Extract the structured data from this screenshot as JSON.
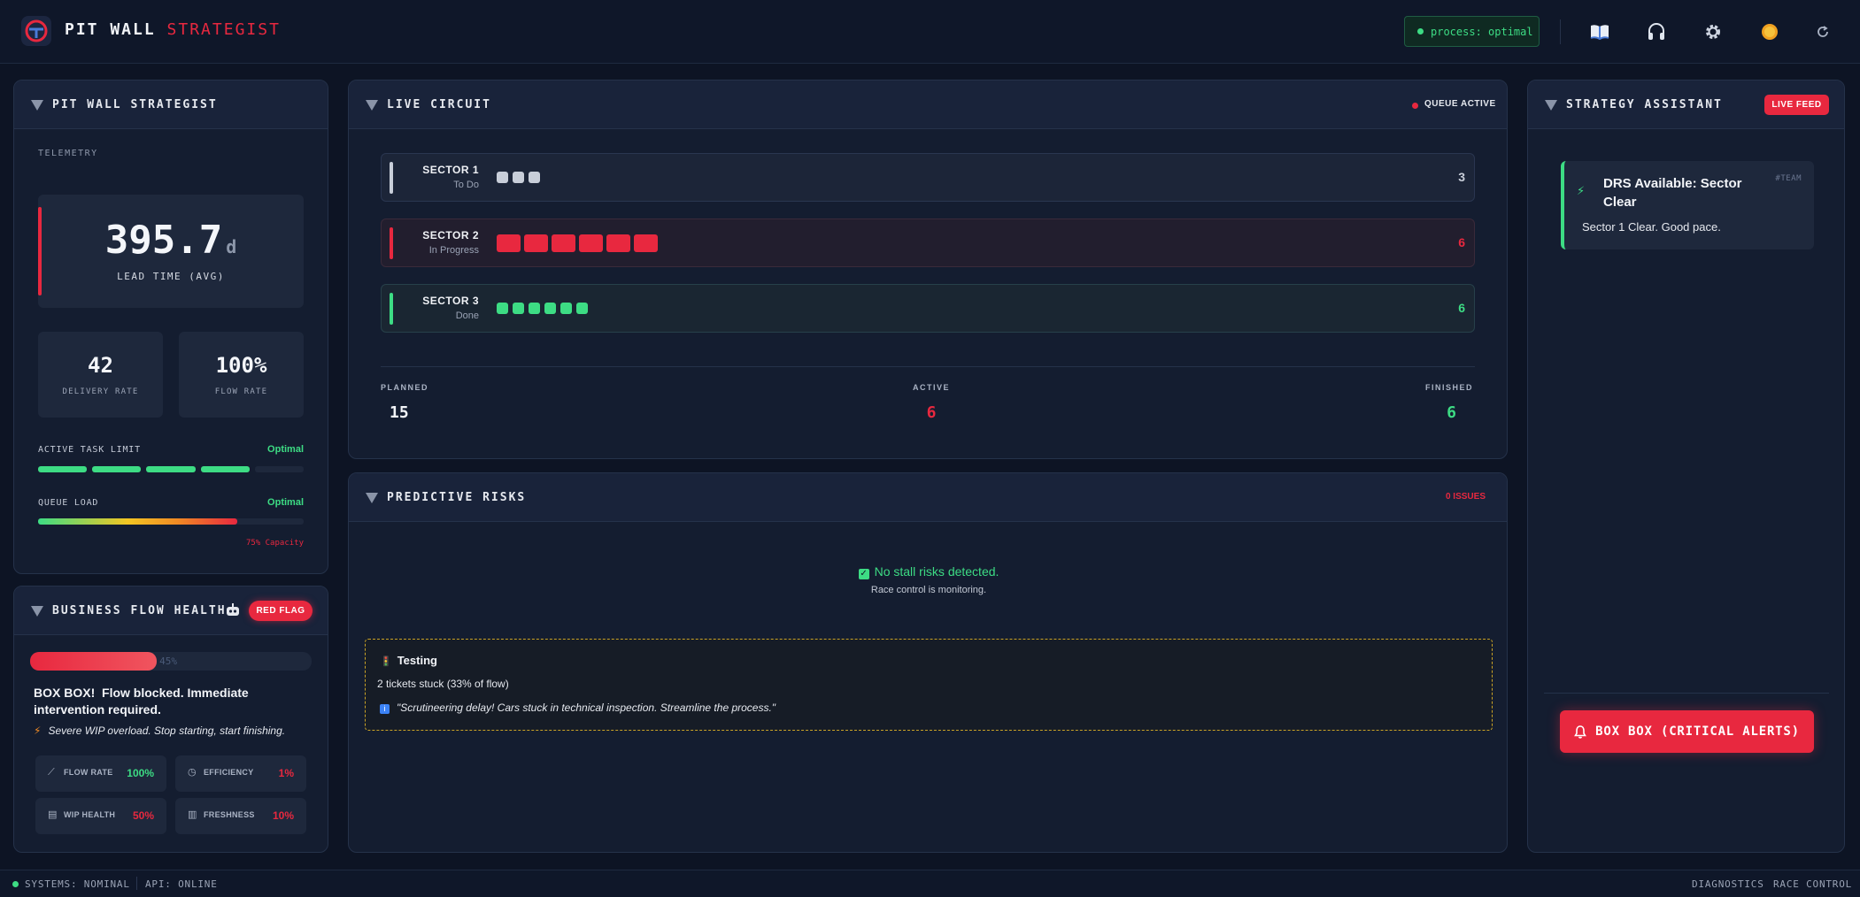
{
  "app": {
    "title_main": "PIT WALL",
    "title_accent": "STRATEGIST",
    "process_status": "process: optimal"
  },
  "toolbar": {
    "icons": [
      "book-icon",
      "headphones-icon",
      "gear-icon",
      "sun-icon",
      "refresh-icon"
    ]
  },
  "left_panel": {
    "title": "PIT WALL STRATEGIST",
    "section_label": "TELEMETRY",
    "lead_time": {
      "value": "395.7",
      "unit": "d",
      "label": "LEAD TIME (AVG)"
    },
    "delivery": {
      "value": "42",
      "label": "DELIVERY RATE"
    },
    "flow": {
      "value": "100%",
      "label": "FLOW RATE"
    },
    "task_limit": {
      "label": "ACTIVE TASK LIMIT",
      "status": "Optimal",
      "filled_segments": 4,
      "total_segments": 5
    },
    "queue_load": {
      "label": "QUEUE LOAD",
      "status": "Optimal",
      "fill": 0.75,
      "capacity_text": "75% Capacity"
    }
  },
  "business_panel": {
    "title": "BUSINESS FLOW HEALTH",
    "flag": "RED FLAG",
    "health_percent": 45,
    "health_text": "45%",
    "alert_strong": "BOX BOX!",
    "alert_text": "Flow blocked. Immediate intervention required.",
    "note": "Severe WIP overload. Stop starting, start finishing.",
    "metrics": [
      {
        "label": "FLOW RATE",
        "value": "100%",
        "color": "#3ddc84"
      },
      {
        "label": "EFFICIENCY",
        "value": "1%",
        "color": "#e8283f"
      },
      {
        "label": "WIP HEALTH",
        "value": "50%",
        "color": "#e8283f"
      },
      {
        "label": "FRESHNESS",
        "value": "10%",
        "color": "#e8283f"
      }
    ]
  },
  "circuit": {
    "title": "LIVE CIRCUIT",
    "queue_status": "QUEUE ACTIVE",
    "sectors": [
      {
        "name": "SECTOR 1",
        "status": "To Do",
        "count": "3",
        "color": "#c8ced9"
      },
      {
        "name": "SECTOR 2",
        "status": "In Progress",
        "count": "6",
        "color": "#e8283f"
      },
      {
        "name": "SECTOR 3",
        "status": "Done",
        "count": "6",
        "color": "#3ddc84"
      }
    ],
    "summary": {
      "planned_label": "PLANNED",
      "planned": "15",
      "active_label": "ACTIVE",
      "active": "6",
      "finished_label": "FINISHED",
      "finished": "6"
    }
  },
  "risks": {
    "title": "PREDICTIVE RISKS",
    "issues": "0 ISSUES",
    "ok_text": "No stall risks detected.",
    "ok_sub": "Race control is monitoring.",
    "alert_title": "Testing",
    "alert_line": "2 tickets stuck (33% of flow)",
    "alert_quote": "\"Scrutineering delay! Cars stuck in technical inspection. Streamline the process.\""
  },
  "assistant": {
    "title": "STRATEGY ASSISTANT",
    "live_badge": "LIVE FEED",
    "message_title": "DRS Available: Sector Clear",
    "message_tag": "#TEAM",
    "message_body": "Sector 1 Clear. Good pace.",
    "cta": "BOX BOX (CRITICAL ALERTS)"
  },
  "footer": {
    "systems": "SYSTEMS: NOMINAL",
    "api": "API: ONLINE",
    "diagnostics": "DIAGNOSTICS",
    "race_control": "RACE CONTROL"
  }
}
